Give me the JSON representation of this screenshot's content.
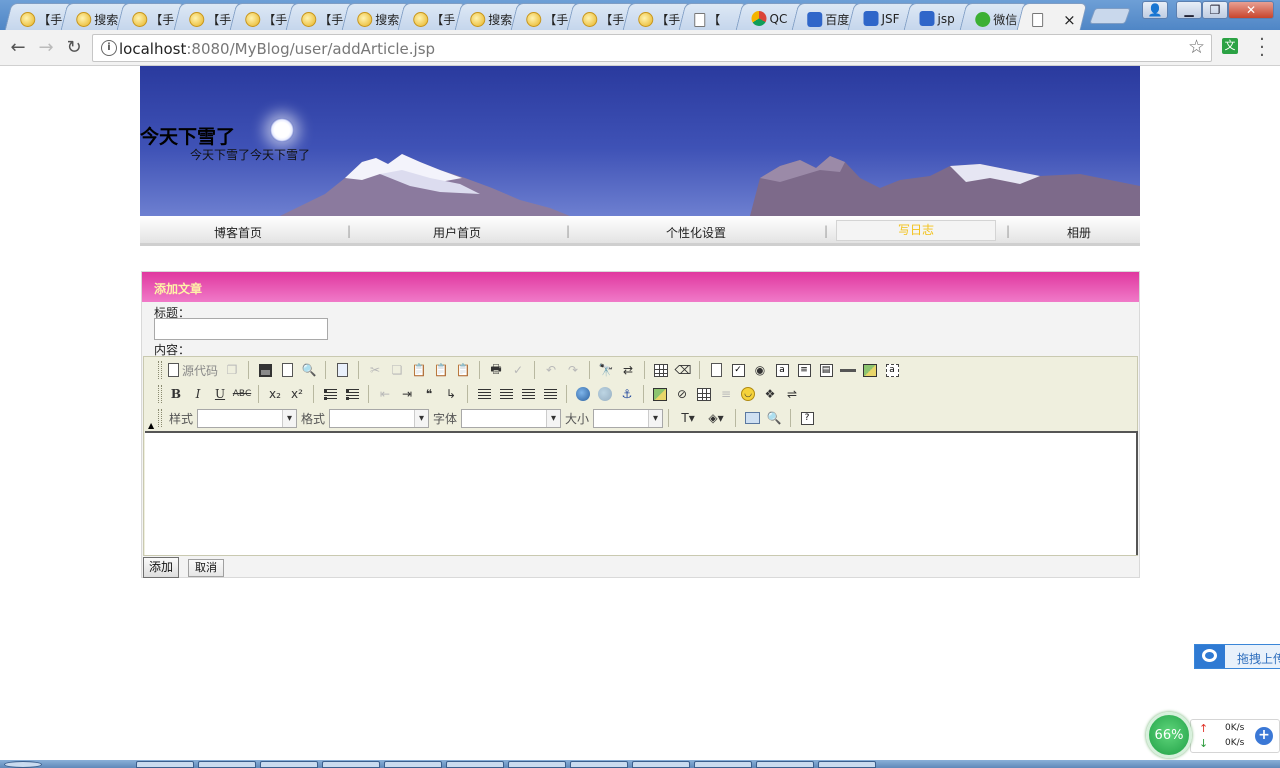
{
  "browser": {
    "tabs": [
      {
        "icon": "yellow-icon",
        "title": "【手"
      },
      {
        "icon": "yellow-icon",
        "title": "搜索"
      },
      {
        "icon": "yellow-icon",
        "title": "【手"
      },
      {
        "icon": "yellow-icon",
        "title": "【手"
      },
      {
        "icon": "yellow-icon",
        "title": "【手"
      },
      {
        "icon": "yellow-icon",
        "title": "【手"
      },
      {
        "icon": "yellow-icon",
        "title": "搜索"
      },
      {
        "icon": "yellow-icon",
        "title": "【手"
      },
      {
        "icon": "yellow-icon",
        "title": "搜索"
      },
      {
        "icon": "yellow-icon",
        "title": "【手"
      },
      {
        "icon": "yellow-icon",
        "title": "【手"
      },
      {
        "icon": "yellow-icon",
        "title": "【手"
      },
      {
        "icon": "doc-icon",
        "title": "【"
      },
      {
        "icon": "chrome-icon",
        "title": "QC"
      },
      {
        "icon": "paw-icon",
        "title": "百度"
      },
      {
        "icon": "paw-icon",
        "title": "JSF"
      },
      {
        "icon": "paw-icon",
        "title": "jsp"
      },
      {
        "icon": "wechat-icon",
        "title": "微信"
      },
      {
        "icon": "doc-icon",
        "title": "",
        "active": true
      }
    ],
    "url_host": "localhost",
    "url_rest": ":8080/MyBlog/user/addArticle.jsp",
    "translate_label": "文",
    "close_glyph": "×"
  },
  "site": {
    "title": "今天下雪了",
    "subtitle": "今天下雪了今天下雪了"
  },
  "nav": {
    "items": [
      "博客首页",
      "用户首页",
      "个性化设置",
      "写日志",
      "相册"
    ],
    "active_index": 3
  },
  "form": {
    "header": "添加文章",
    "title_label": "标题：",
    "title_value": "",
    "content_label": "内容：",
    "add_button": "添加",
    "cancel_button": "取消"
  },
  "editor": {
    "source_label": "源代码",
    "style_label": "样式",
    "format_label": "格式",
    "font_label": "字体",
    "size_label": "大小",
    "style_value": "",
    "format_value": "",
    "font_value": "",
    "size_value": ""
  },
  "widgets": {
    "upload_label": "拖拽上传",
    "netmon_percent": "66%",
    "upload_speed": "0K/s",
    "download_speed": "0K/s"
  },
  "colors": {
    "panel_header": "#e0389f",
    "panel_header_text": "#fff3a8",
    "nav_active_text": "#f2c21b"
  }
}
